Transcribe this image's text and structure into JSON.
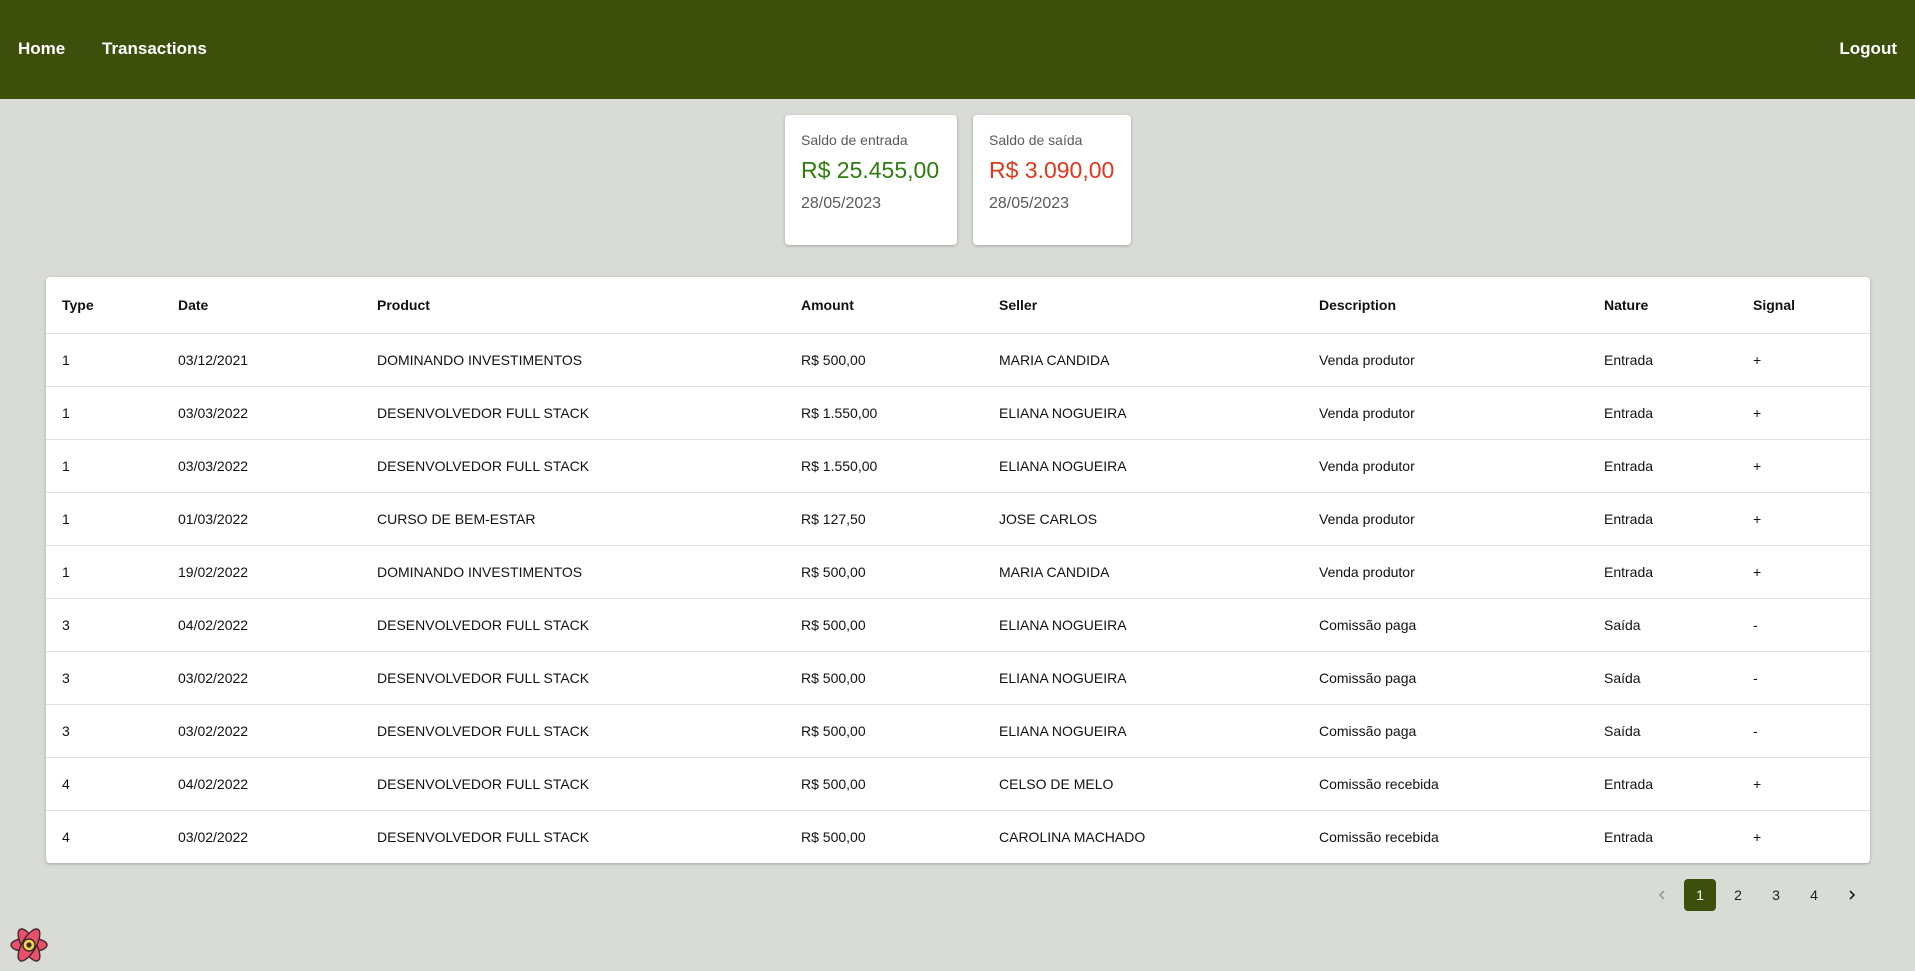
{
  "nav": {
    "home": "Home",
    "transactions": "Transactions",
    "logout": "Logout"
  },
  "colors": {
    "header": "#3c4f0b",
    "background": "#d9dbd6",
    "income": "#2e7d0e",
    "outcome": "#e2361b"
  },
  "cards": {
    "income": {
      "label": "Saldo de entrada",
      "value": "R$ 25.455,00",
      "date": "28/05/2023"
    },
    "outcome": {
      "label": "Saldo de saída",
      "value": "R$ 3.090,00",
      "date": "28/05/2023"
    }
  },
  "table": {
    "headers": [
      "Type",
      "Date",
      "Product",
      "Amount",
      "Seller",
      "Description",
      "Nature",
      "Signal"
    ],
    "rows": [
      [
        "1",
        "03/12/2021",
        "DOMINANDO INVESTIMENTOS",
        "R$ 500,00",
        "MARIA CANDIDA",
        "Venda produtor",
        "Entrada",
        "+"
      ],
      [
        "1",
        "03/03/2022",
        "DESENVOLVEDOR FULL STACK",
        "R$ 1.550,00",
        "ELIANA NOGUEIRA",
        "Venda produtor",
        "Entrada",
        "+"
      ],
      [
        "1",
        "03/03/2022",
        "DESENVOLVEDOR FULL STACK",
        "R$ 1.550,00",
        "ELIANA NOGUEIRA",
        "Venda produtor",
        "Entrada",
        "+"
      ],
      [
        "1",
        "01/03/2022",
        "CURSO DE BEM-ESTAR",
        "R$ 127,50",
        "JOSE CARLOS",
        "Venda produtor",
        "Entrada",
        "+"
      ],
      [
        "1",
        "19/02/2022",
        "DOMINANDO INVESTIMENTOS",
        "R$ 500,00",
        "MARIA CANDIDA",
        "Venda produtor",
        "Entrada",
        "+"
      ],
      [
        "3",
        "04/02/2022",
        "DESENVOLVEDOR FULL STACK",
        "R$ 500,00",
        "ELIANA NOGUEIRA",
        "Comissão paga",
        "Saída",
        "-"
      ],
      [
        "3",
        "03/02/2022",
        "DESENVOLVEDOR FULL STACK",
        "R$ 500,00",
        "ELIANA NOGUEIRA",
        "Comissão paga",
        "Saída",
        "-"
      ],
      [
        "3",
        "03/02/2022",
        "DESENVOLVEDOR FULL STACK",
        "R$ 500,00",
        "ELIANA NOGUEIRA",
        "Comissão paga",
        "Saída",
        "-"
      ],
      [
        "4",
        "04/02/2022",
        "DESENVOLVEDOR FULL STACK",
        "R$ 500,00",
        "CELSO DE MELO",
        "Comissão recebida",
        "Entrada",
        "+"
      ],
      [
        "4",
        "03/02/2022",
        "DESENVOLVEDOR FULL STACK",
        "R$ 500,00",
        "CAROLINA MACHADO",
        "Comissão recebida",
        "Entrada",
        "+"
      ]
    ]
  },
  "pagination": {
    "prev_icon": "chevron-left-icon",
    "next_icon": "chevron-right-icon",
    "pages": [
      "1",
      "2",
      "3",
      "4"
    ],
    "current": "1"
  },
  "devtools_icon": "react-logo-icon"
}
